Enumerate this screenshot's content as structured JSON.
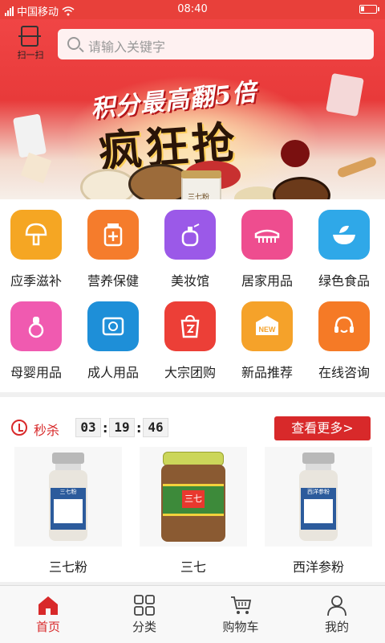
{
  "status_bar": {
    "carrier": "中国移动",
    "time": "08:40"
  },
  "header": {
    "scan_label": "扫一扫",
    "search_placeholder": "请输入关键字"
  },
  "banner": {
    "title": "积分最高翻5倍",
    "subtitle": "疯狂抢",
    "product_text": "三七粉"
  },
  "categories": [
    {
      "label": "应季滋补",
      "icon": "mushroom-icon",
      "color": "#f5a623"
    },
    {
      "label": "营养保健",
      "icon": "medicine-bottle-icon",
      "color": "#f57c2c"
    },
    {
      "label": "美妆馆",
      "icon": "perfume-icon",
      "color": "#9b59e8"
    },
    {
      "label": "居家用品",
      "icon": "brush-icon",
      "color": "#ee4d8f"
    },
    {
      "label": "绿色食品",
      "icon": "bowl-leaf-icon",
      "color": "#2fa8e8"
    },
    {
      "label": "母婴用品",
      "icon": "pacifier-icon",
      "color": "#f05ab0"
    },
    {
      "label": "成人用品",
      "icon": "condom-icon",
      "color": "#1e8fd8"
    },
    {
      "label": "大宗团购",
      "icon": "shopping-bag-icon",
      "color": "#ec3f37"
    },
    {
      "label": "新品推荐",
      "icon": "new-badge-icon",
      "color": "#f5a22a"
    },
    {
      "label": "在线咨询",
      "icon": "support-headset-icon",
      "color": "#f57a26"
    }
  ],
  "flash_sale": {
    "title": "秒杀",
    "countdown": {
      "hours": "03",
      "minutes": "19",
      "seconds": "46"
    },
    "more_label": "查看更多>",
    "products": [
      {
        "name": "三七粉",
        "image": "bottle",
        "label_title": "三七粉"
      },
      {
        "name": "三七",
        "image": "jar",
        "label_title": "三七"
      },
      {
        "name": "西洋参粉",
        "image": "bottle",
        "label_title": "西洋参粉"
      }
    ]
  },
  "bottom_nav": [
    {
      "label": "首页",
      "icon": "home-icon",
      "active": true
    },
    {
      "label": "分类",
      "icon": "grid-icon",
      "active": false
    },
    {
      "label": "购物车",
      "icon": "cart-icon",
      "active": false
    },
    {
      "label": "我的",
      "icon": "user-icon",
      "active": false
    }
  ],
  "colors": {
    "accent": "#d8292a",
    "status_bar": "#e8403a"
  }
}
